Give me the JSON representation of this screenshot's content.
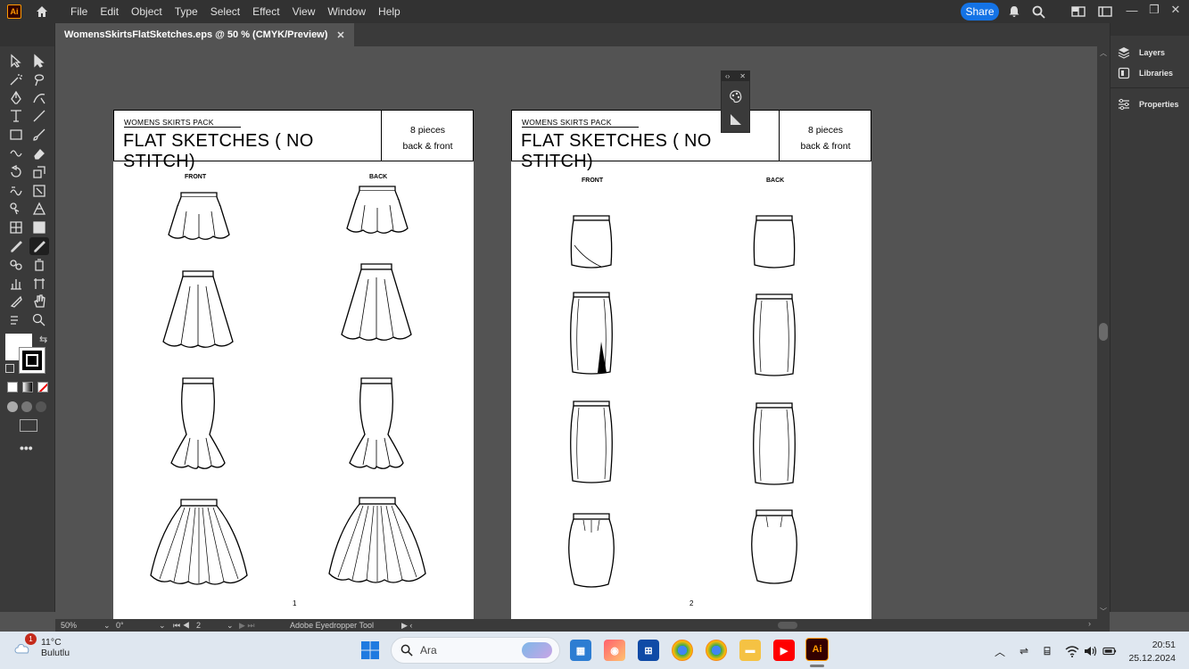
{
  "app": {
    "logo": "Ai",
    "menu": [
      "File",
      "Edit",
      "Object",
      "Type",
      "Select",
      "Effect",
      "View",
      "Window",
      "Help"
    ],
    "share_label": "Share"
  },
  "document": {
    "tab_title": "WomensSkirtsFlatSketches.eps @ 50 % (CMYK/Preview)",
    "tab_close": "✕"
  },
  "right_panel": {
    "items": [
      {
        "label": "Layers",
        "icon": "layers-icon"
      },
      {
        "label": "Libraries",
        "icon": "libraries-icon"
      },
      {
        "label": "Properties",
        "icon": "properties-icon"
      }
    ]
  },
  "artboards": [
    {
      "pack_label": "WOMENS SKIRTS PACK",
      "title": "FLAT SKETCHES ( NO STITCH)",
      "pieces": "8 pieces",
      "views": "back & front",
      "front_label": "FRONT",
      "back_label": "BACK",
      "page_number": "1"
    },
    {
      "pack_label": "WOMENS SKIRTS PACK",
      "title": "FLAT SKETCHES ( NO STITCH)",
      "pieces": "8 pieces",
      "views": "back & front",
      "front_label": "FRONT",
      "back_label": "BACK",
      "page_number": "2"
    }
  ],
  "status_bar": {
    "zoom": "50%",
    "rotation": "0°",
    "artboard": "2",
    "current_tool": "Adobe Eyedropper Tool"
  },
  "taskbar": {
    "weather_temp": "11°C",
    "weather_desc": "Bulutlu",
    "weather_badge": "1",
    "search_placeholder": "Ara",
    "time": "20:51",
    "date": "25.12.2024"
  }
}
